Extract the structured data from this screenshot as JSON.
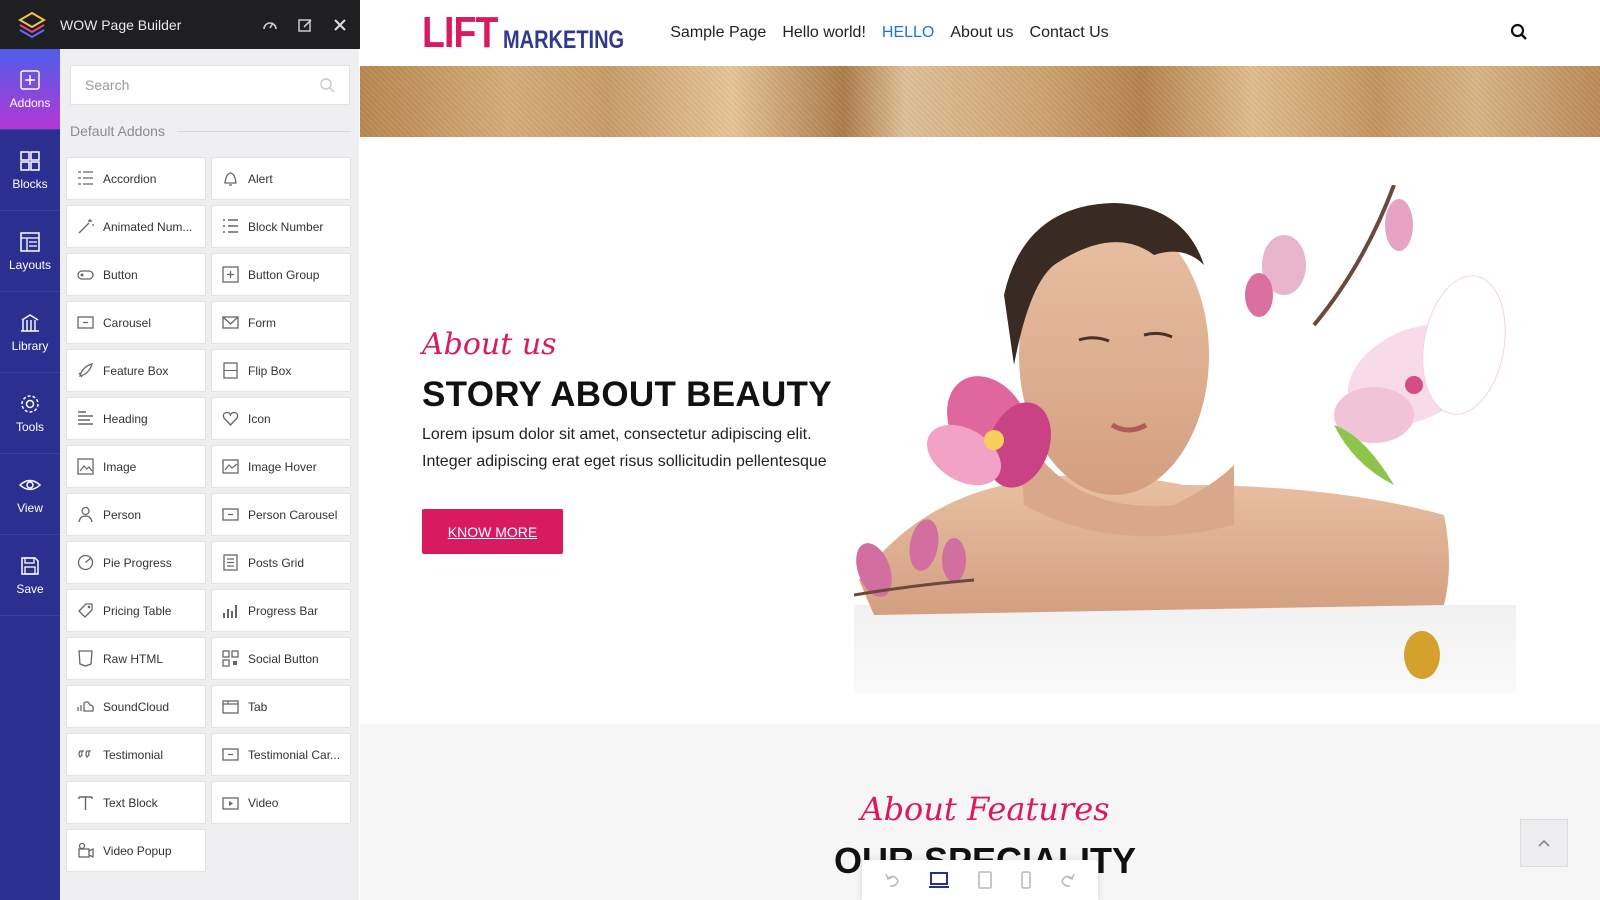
{
  "builder": {
    "title": "WOW Page Builder",
    "rail": [
      {
        "label": "Addons",
        "icon": "plus-square-icon"
      },
      {
        "label": "Blocks",
        "icon": "blocks-icon"
      },
      {
        "label": "Layouts",
        "icon": "layouts-icon"
      },
      {
        "label": "Library",
        "icon": "library-icon"
      },
      {
        "label": "Tools",
        "icon": "gear-icon"
      },
      {
        "label": "View",
        "icon": "eye-icon"
      },
      {
        "label": "Save",
        "icon": "save-icon"
      }
    ],
    "search_placeholder": "Search",
    "section_title": "Default Addons",
    "addons": [
      {
        "label": "Accordion",
        "icon": "list-icon"
      },
      {
        "label": "Alert",
        "icon": "bell-icon"
      },
      {
        "label": "Animated Num...",
        "icon": "wand-icon"
      },
      {
        "label": "Block Number",
        "icon": "numbered-list-icon"
      },
      {
        "label": "Button",
        "icon": "button-icon"
      },
      {
        "label": "Button Group",
        "icon": "button-group-icon"
      },
      {
        "label": "Carousel",
        "icon": "carousel-icon"
      },
      {
        "label": "Form",
        "icon": "envelope-icon"
      },
      {
        "label": "Feature Box",
        "icon": "rocket-icon"
      },
      {
        "label": "Flip Box",
        "icon": "flip-box-icon"
      },
      {
        "label": "Heading",
        "icon": "heading-icon"
      },
      {
        "label": "Icon",
        "icon": "heart-icon"
      },
      {
        "label": "Image",
        "icon": "image-icon"
      },
      {
        "label": "Image Hover",
        "icon": "image-hover-icon"
      },
      {
        "label": "Person",
        "icon": "person-icon"
      },
      {
        "label": "Person Carousel",
        "icon": "carousel-icon"
      },
      {
        "label": "Pie Progress",
        "icon": "pie-icon"
      },
      {
        "label": "Posts Grid",
        "icon": "document-icon"
      },
      {
        "label": "Pricing Table",
        "icon": "tag-icon"
      },
      {
        "label": "Progress Bar",
        "icon": "bars-icon"
      },
      {
        "label": "Raw HTML",
        "icon": "html5-icon"
      },
      {
        "label": "Social Button",
        "icon": "qr-icon"
      },
      {
        "label": "SoundCloud",
        "icon": "soundcloud-icon"
      },
      {
        "label": "Tab",
        "icon": "tab-icon"
      },
      {
        "label": "Testimonial",
        "icon": "quote-icon"
      },
      {
        "label": "Testimonial Car...",
        "icon": "carousel-icon"
      },
      {
        "label": "Text Block",
        "icon": "text-icon"
      },
      {
        "label": "Video",
        "icon": "video-icon"
      },
      {
        "label": "Video Popup",
        "icon": "video-camera-icon"
      }
    ]
  },
  "site": {
    "brand_part1": "LIFT",
    "brand_part2": "MARKETING",
    "menu": [
      "Sample Page",
      "Hello world!",
      "HELLO",
      "About us",
      "Contact Us"
    ],
    "active_menu": "HELLO",
    "hero": {
      "script": "About us",
      "heading": "STORY ABOUT BEAUTY",
      "line1": "Lorem ipsum dolor sit amet, consectetur adipiscing elit.",
      "line2": "Integer adipiscing erat eget risus sollicitudin pellentesque",
      "button": "KNOW MORE"
    },
    "features": {
      "script": "About Features",
      "heading": "OUR SPECIALITY"
    }
  },
  "colors": {
    "accent": "#d81b60",
    "rail": "#2b2f8f",
    "link_active": "#1a73e8"
  }
}
